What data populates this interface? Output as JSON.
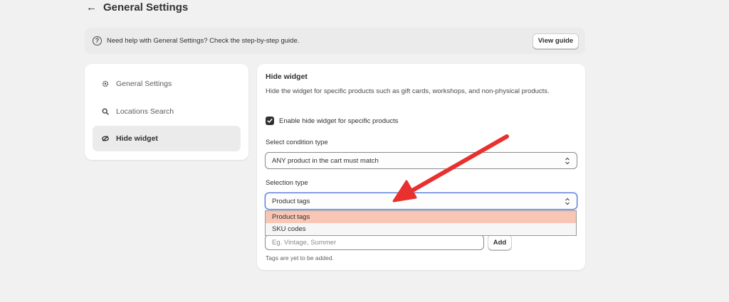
{
  "header": {
    "back_icon": "arrow-left-icon",
    "title": "General Settings"
  },
  "banner": {
    "icon": "help-circle-icon",
    "text": "Need help with General Settings? Check the step-by-step guide.",
    "button_label": "View guide"
  },
  "sidebar": {
    "items": [
      {
        "label": "General Settings",
        "icon": "gear-icon",
        "active": false
      },
      {
        "label": "Locations Search",
        "icon": "search-icon",
        "active": false
      },
      {
        "label": "Hide widget",
        "icon": "eye-off-icon",
        "active": true
      }
    ]
  },
  "hide_widget": {
    "title": "Hide widget",
    "description": "Hide the widget for specific products such as gift cards, workshops, and non-physical products.",
    "enable_checkbox": {
      "label": "Enable hide widget for specific products",
      "checked": true
    },
    "condition_type": {
      "label": "Select condition type",
      "value": "ANY product in the cart must match"
    },
    "selection_type": {
      "label": "Selection type",
      "value": "Product tags",
      "options": [
        "Product tags",
        "SKU codes"
      ],
      "highlighted_option": "Product tags"
    },
    "tags_input": {
      "placeholder": "Eg. Vintage, Summer",
      "value": ""
    },
    "add_button_label": "Add",
    "empty_hint": "Tags are yet to be added."
  },
  "annotation": {
    "type": "arrow",
    "color": "#e8312f"
  },
  "colors": {
    "background": "#f1f1f1",
    "focus": "#4b6fd6",
    "dropdown_highlight": "#f9c6b6"
  }
}
